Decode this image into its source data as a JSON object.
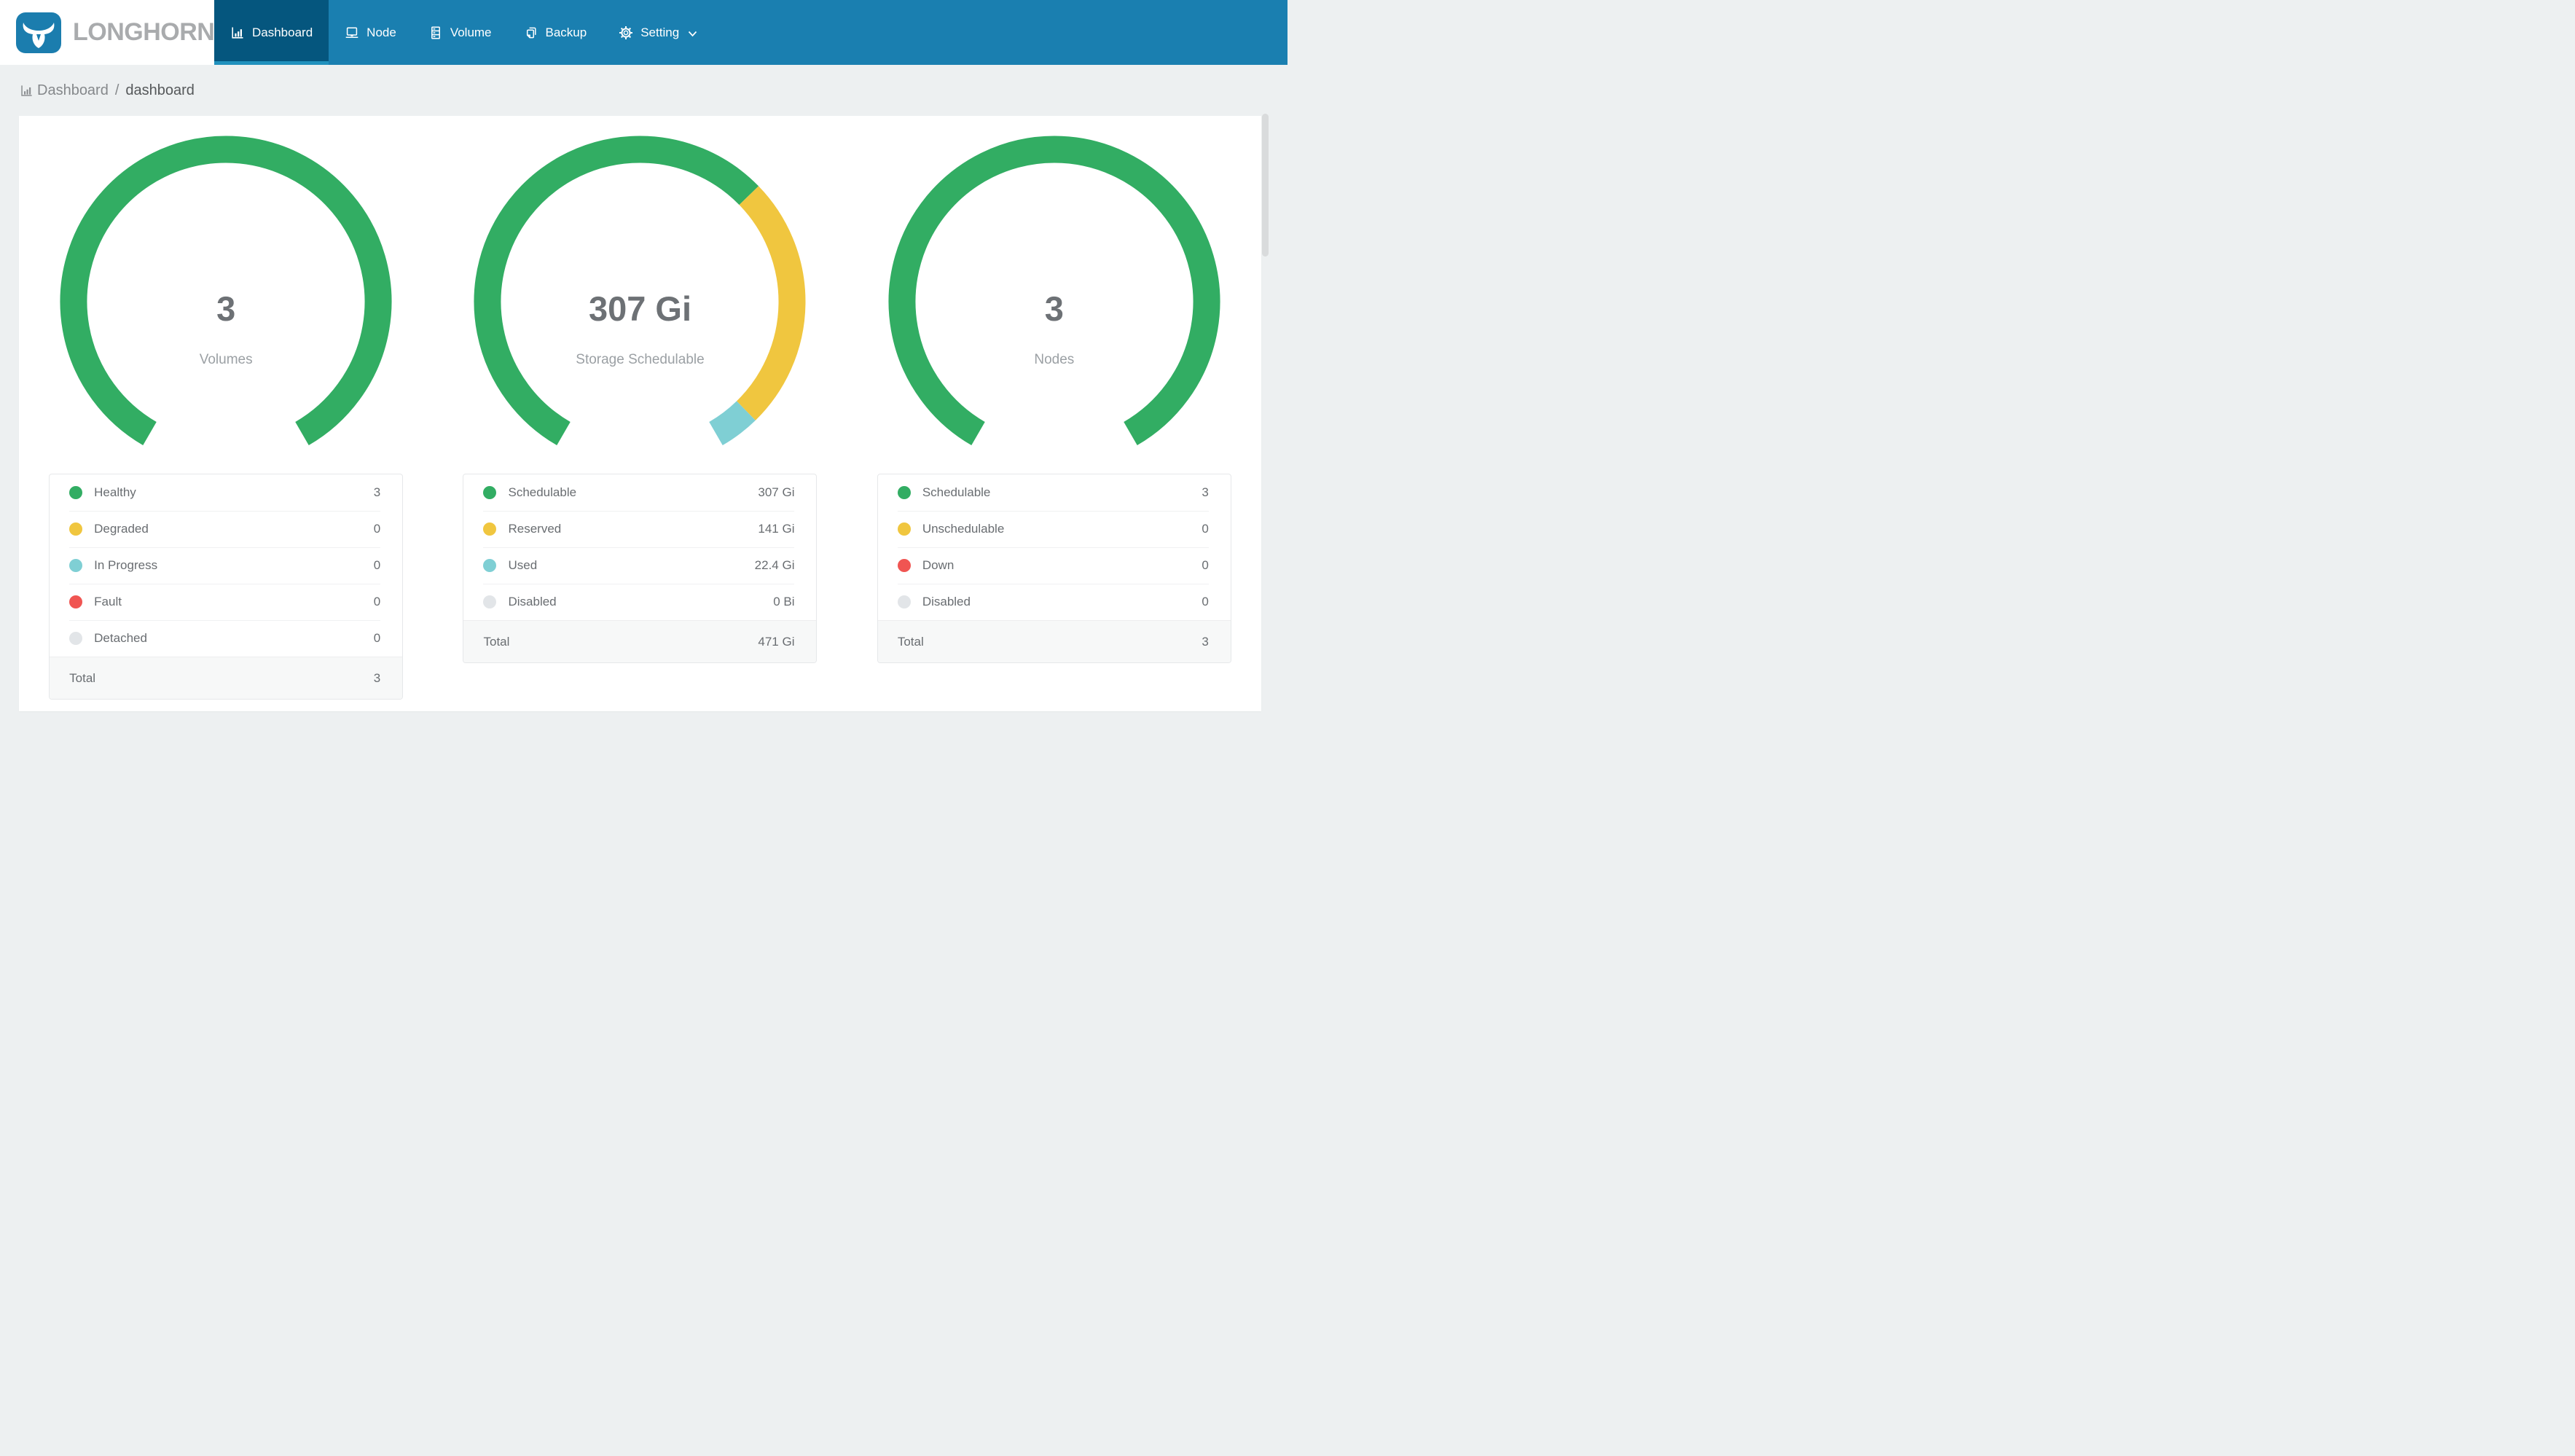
{
  "nav": {
    "brand": "LONGHORN",
    "items": [
      {
        "label": "Dashboard",
        "icon": "bar-chart-icon",
        "active": true
      },
      {
        "label": "Node",
        "icon": "laptop-icon",
        "active": false
      },
      {
        "label": "Volume",
        "icon": "server-icon",
        "active": false
      },
      {
        "label": "Backup",
        "icon": "copy-icon",
        "active": false
      },
      {
        "label": "Setting",
        "icon": "gear-icon",
        "active": false,
        "has_dropdown": true
      }
    ]
  },
  "breadcrumb": {
    "section": "Dashboard",
    "separator": "/",
    "page": "dashboard"
  },
  "colors": {
    "navbar": "#1a7fb0",
    "navbar_active": "#05567e",
    "navbar_active_strip": "#2191bd",
    "logo_blue": "#1b7dae",
    "brand_text": "#a9abad",
    "page_background": "#edf0f1",
    "card_background": "#ffffff",
    "green": "#32ad63",
    "yellow": "#f0c63f",
    "teal": "#7fcfd4",
    "red": "#f05552",
    "gray": "#e2e5e8"
  },
  "chart_data": [
    {
      "type": "donut",
      "name": "volumes",
      "center_value": "3",
      "center_label": "Volumes",
      "start_angle": 210,
      "total_sweep": 300,
      "segments": [
        {
          "label": "Healthy",
          "value": 3,
          "display": "3",
          "color": "#32ad63"
        },
        {
          "label": "Degraded",
          "value": 0,
          "display": "0",
          "color": "#f0c63f"
        },
        {
          "label": "In Progress",
          "value": 0,
          "display": "0",
          "color": "#7fcfd4"
        },
        {
          "label": "Fault",
          "value": 0,
          "display": "0",
          "color": "#f05552"
        },
        {
          "label": "Detached",
          "value": 0,
          "display": "0",
          "color": "#e2e5e8"
        }
      ],
      "total": {
        "label": "Total",
        "display": "3"
      }
    },
    {
      "type": "donut",
      "name": "storage-schedulable",
      "center_value": "307 Gi",
      "center_label": "Storage Schedulable",
      "start_angle": 210,
      "total_sweep": 300,
      "segments": [
        {
          "label": "Schedulable",
          "value": 307,
          "display": "307 Gi",
          "color": "#32ad63"
        },
        {
          "label": "Reserved",
          "value": 141,
          "display": "141 Gi",
          "color": "#f0c63f"
        },
        {
          "label": "Used",
          "value": 22.4,
          "display": "22.4 Gi",
          "color": "#7fcfd4"
        },
        {
          "label": "Disabled",
          "value": 0,
          "display": "0 Bi",
          "color": "#e2e5e8"
        }
      ],
      "total": {
        "label": "Total",
        "display": "471 Gi"
      }
    },
    {
      "type": "donut",
      "name": "nodes",
      "center_value": "3",
      "center_label": "Nodes",
      "start_angle": 210,
      "total_sweep": 300,
      "segments": [
        {
          "label": "Schedulable",
          "value": 3,
          "display": "3",
          "color": "#32ad63"
        },
        {
          "label": "Unschedulable",
          "value": 0,
          "display": "0",
          "color": "#f0c63f"
        },
        {
          "label": "Down",
          "value": 0,
          "display": "0",
          "color": "#f05552"
        },
        {
          "label": "Disabled",
          "value": 0,
          "display": "0",
          "color": "#e2e5e8"
        }
      ],
      "total": {
        "label": "Total",
        "display": "3"
      }
    }
  ]
}
